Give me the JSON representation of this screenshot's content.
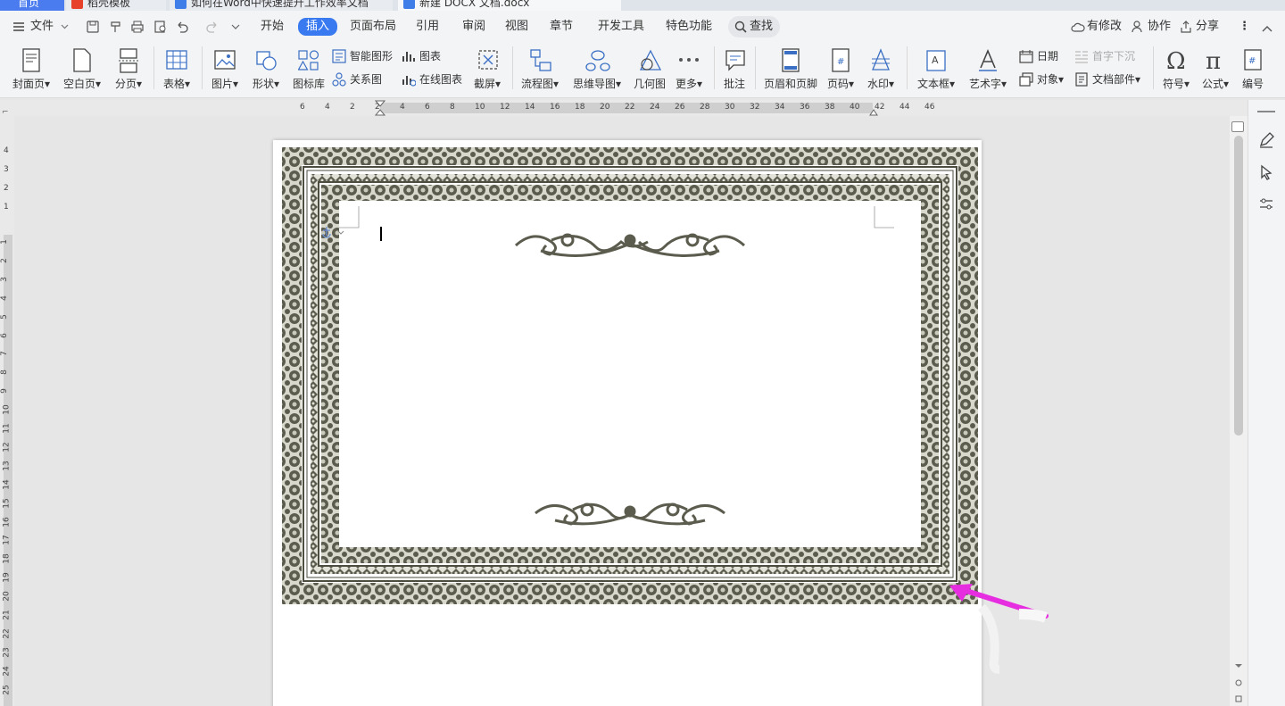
{
  "tabs": [
    {
      "label": "首页",
      "active": false
    },
    {
      "label": "稻壳模板",
      "active": false
    },
    {
      "label": "如何在Word中快速提升工作效率文档",
      "active": false
    },
    {
      "label": "新建 DOCX 文档.docx",
      "active": true
    }
  ],
  "menu": {
    "file_label": "文件",
    "items": [
      "开始",
      "插入",
      "页面布局",
      "引用",
      "审阅",
      "视图",
      "章节",
      "开发工具",
      "特色功能"
    ],
    "active": "插入",
    "search_label": "查找",
    "right": {
      "modified": "有修改",
      "collab": "协作",
      "share": "分享"
    }
  },
  "ribbon": {
    "cover": "封面页",
    "blank": "空白页",
    "pagebreak": "分页",
    "table": "表格",
    "picture": "图片",
    "shape": "形状",
    "iconlib": "图标库",
    "smartart": "智能图形",
    "chart": "图表",
    "relation": "关系图",
    "onlinechart": "在线图表",
    "screenshot": "截屏",
    "flowchart": "流程图",
    "mindmap": "思维导图",
    "geometry": "几何图",
    "more": "更多",
    "comment": "批注",
    "headerfooter": "页眉和页脚",
    "pagenum": "页码",
    "watermark": "水印",
    "textbox": "文本框",
    "wordart": "艺术字",
    "date": "日期",
    "dropcap": "首字下沉",
    "object": "对象",
    "docpart": "文档部件",
    "symbol": "符号",
    "formula": "公式",
    "numbering": "编号"
  },
  "ruler": {
    "h": [
      "6",
      "4",
      "2",
      "2",
      "4",
      "6",
      "8",
      "10",
      "12",
      "14",
      "16",
      "18",
      "20",
      "22",
      "24",
      "26",
      "28",
      "30",
      "32",
      "34",
      "36",
      "38",
      "40",
      "42",
      "44",
      "46"
    ],
    "v_top": [
      "4",
      "3",
      "2",
      "1"
    ],
    "v": [
      "1",
      "2",
      "3",
      "4",
      "5",
      "6",
      "7",
      "8",
      "9",
      "10",
      "11",
      "12",
      "13",
      "14",
      "15",
      "16",
      "17",
      "18",
      "19",
      "20",
      "21",
      "22",
      "23",
      "24",
      "25"
    ]
  },
  "colors": {
    "accent": "#3a7af0",
    "border_ornament": "#5c5c4e",
    "arrow": "#e62ee0"
  }
}
